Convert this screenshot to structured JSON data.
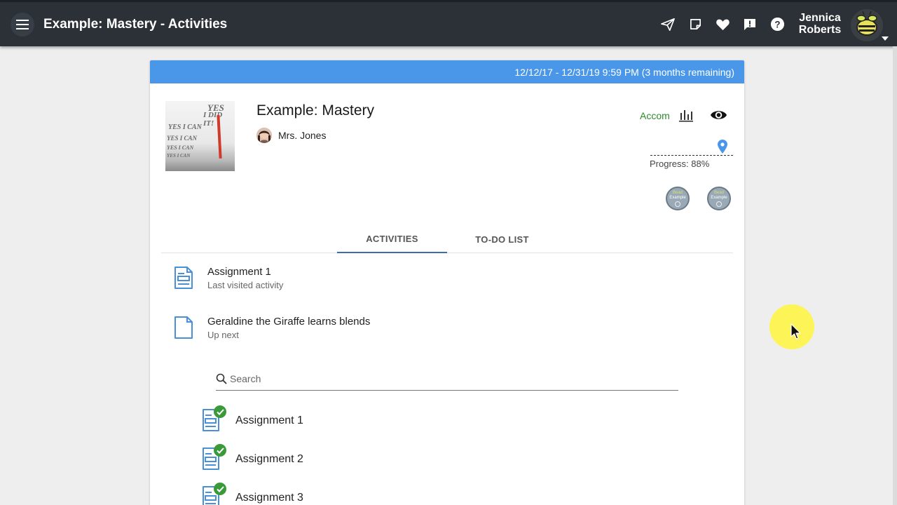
{
  "header": {
    "title": "Example: Mastery - Activities",
    "user_first": "Jennica",
    "user_last": "Roberts",
    "icons": [
      "menu-icon",
      "send-icon",
      "note-icon",
      "heart-icon",
      "feedback-icon",
      "help-icon",
      "bee-avatar",
      "caret-down-icon"
    ]
  },
  "course": {
    "date_range": "12/12/17 - 12/31/19 9:59 PM (3 months remaining)",
    "title": "Example: Mastery",
    "teacher": "Mrs. Jones",
    "accom_label": "Accom",
    "progress_label": "Progress: 88%",
    "progress_value": 88,
    "thumbnail_text": [
      "YES",
      "I DID IT!",
      "YES I CAN",
      "YES I CAN",
      "YES I CAN",
      "YES I CAN"
    ],
    "badges": [
      {
        "top": "Bead",
        "bottom": "Example"
      },
      {
        "top": "Bead",
        "bottom": "Example"
      }
    ]
  },
  "tabs": [
    {
      "label": "ACTIVITIES",
      "active": true
    },
    {
      "label": "TO-DO LIST",
      "active": false
    }
  ],
  "recent": [
    {
      "title": "Assignment 1",
      "subtitle": "Last visited activity"
    },
    {
      "title": "Geraldine the Giraffe learns blends",
      "subtitle": "Up next"
    }
  ],
  "search": {
    "placeholder": "Search"
  },
  "activities": [
    {
      "label": "Assignment 1",
      "completed": true
    },
    {
      "label": "Assignment 2",
      "completed": true
    },
    {
      "label": "Assignment 3",
      "completed": true
    }
  ],
  "colors": {
    "topbar": "#2c3137",
    "date_bar": "#4a97ea",
    "accent": "#3b6ea8",
    "accom": "#2e8b2e",
    "check": "#3a9a3a",
    "doc_icon": "#4a90d9"
  }
}
